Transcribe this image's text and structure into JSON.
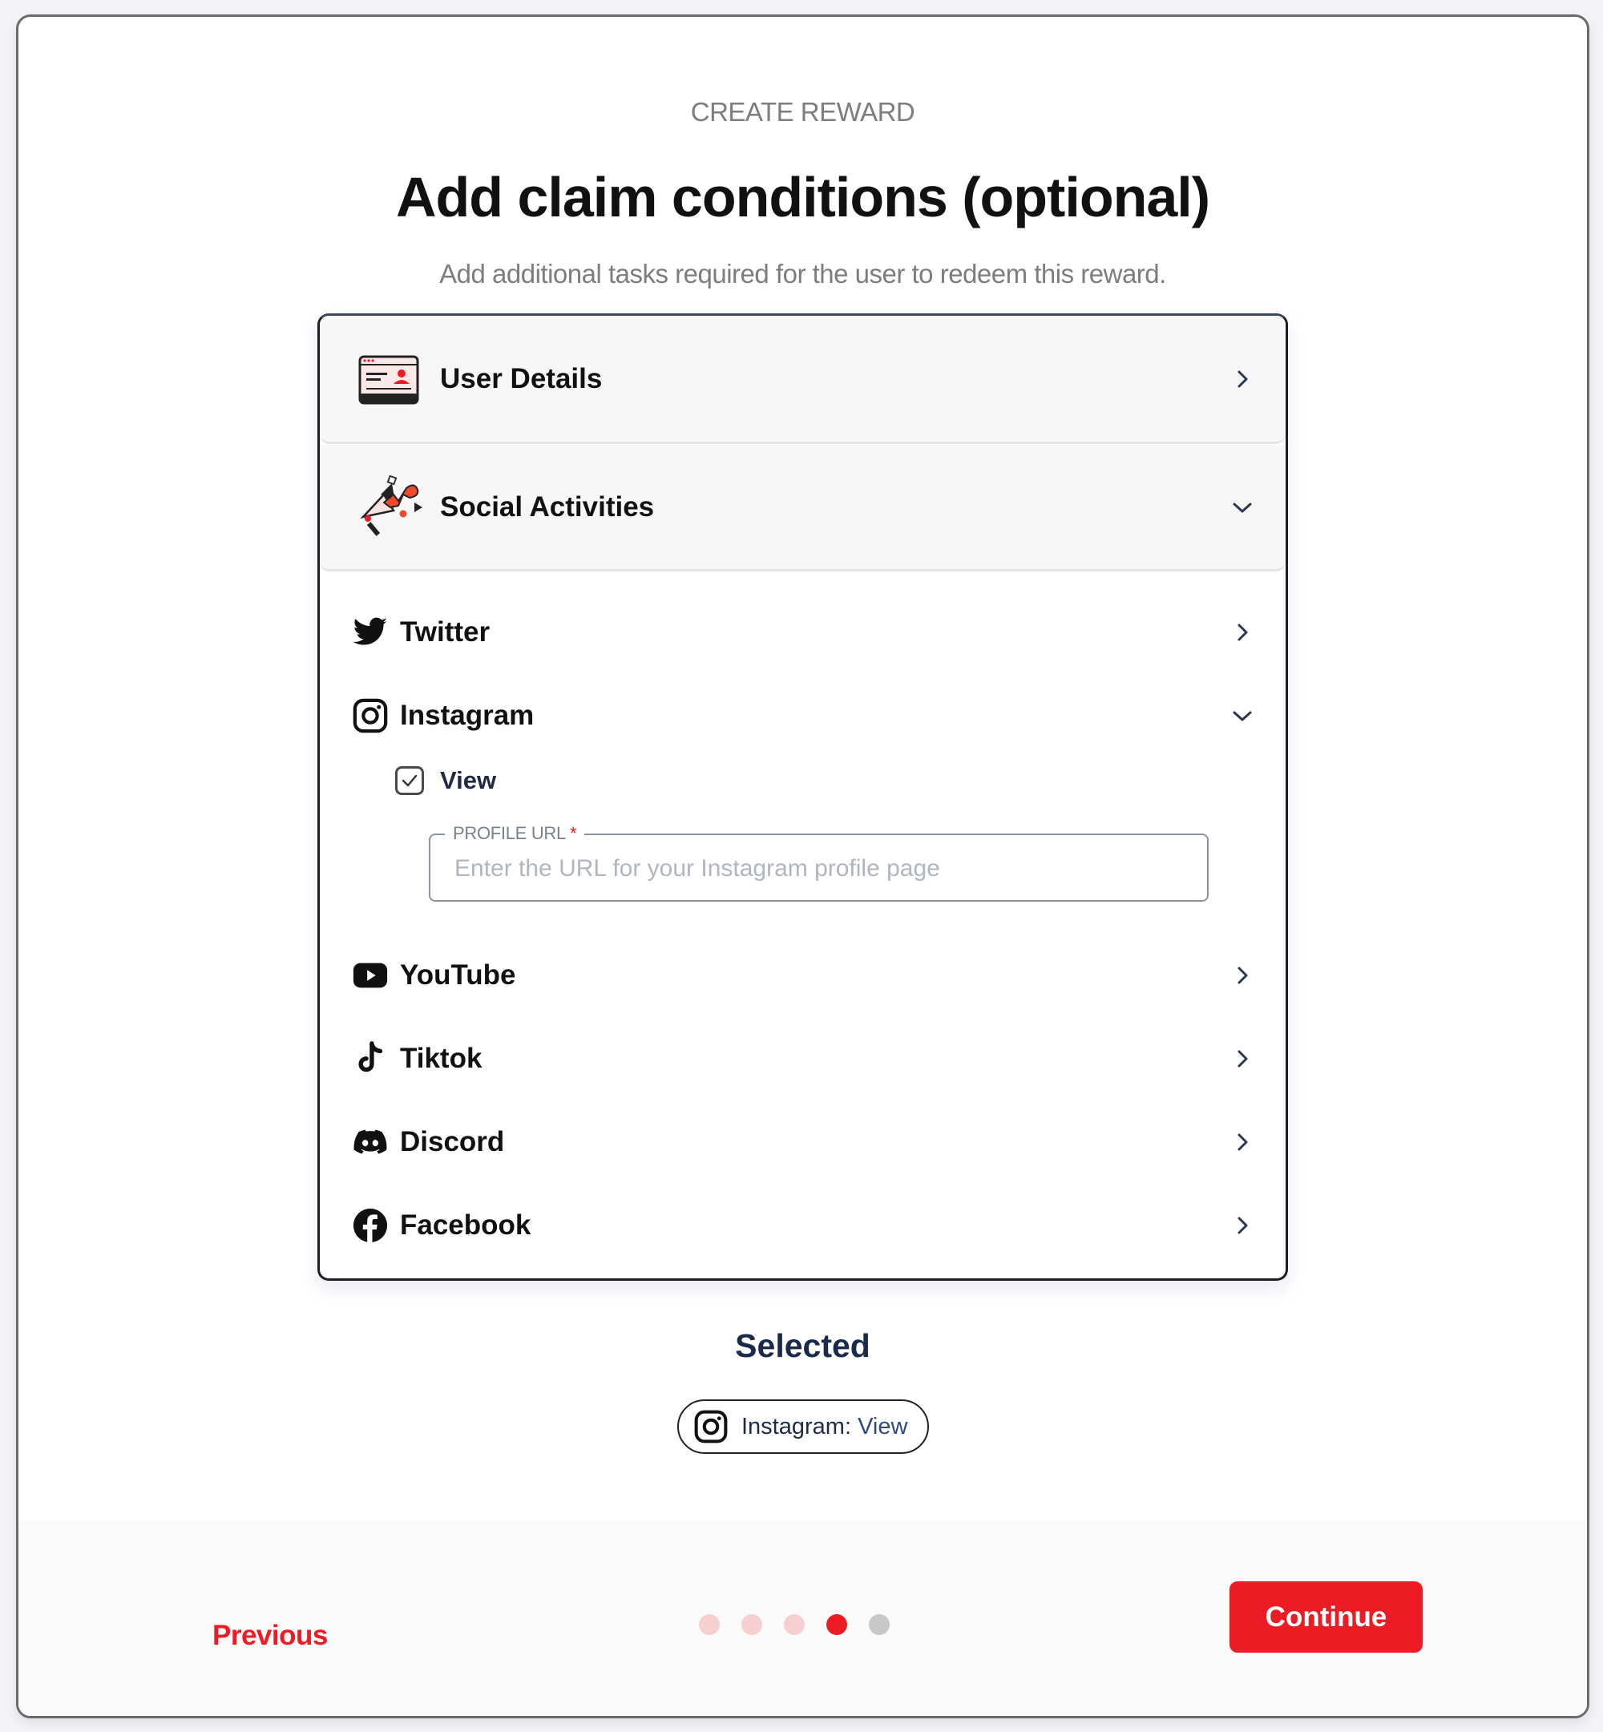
{
  "header": {
    "eyebrow": "CREATE REWARD",
    "title": "Add claim conditions (optional)",
    "subtitle": "Add additional tasks required for the user to redeem this reward."
  },
  "sections": [
    {
      "label": "User Details",
      "icon": "id-card-icon",
      "expanded": false
    },
    {
      "label": "Social Activities",
      "icon": "megaphone-icon",
      "expanded": true
    }
  ],
  "social": {
    "items": [
      {
        "label": "Twitter",
        "icon": "twitter-icon",
        "expanded": false
      },
      {
        "label": "Instagram",
        "icon": "instagram-icon",
        "expanded": true
      },
      {
        "label": "YouTube",
        "icon": "youtube-icon",
        "expanded": false
      },
      {
        "label": "Tiktok",
        "icon": "tiktok-icon",
        "expanded": false
      },
      {
        "label": "Discord",
        "icon": "discord-icon",
        "expanded": false
      },
      {
        "label": "Facebook",
        "icon": "facebook-icon",
        "expanded": false
      }
    ],
    "instagram_options": {
      "view_label": "View",
      "view_checked": true,
      "profile_url_label": "PROFILE URL",
      "profile_url_required_mark": "*",
      "profile_url_value": "",
      "profile_url_placeholder": "Enter the URL for your Instagram profile page"
    }
  },
  "selected": {
    "title": "Selected",
    "chips": [
      {
        "platform": "Instagram",
        "separator": ":",
        "action": "View",
        "icon": "instagram-icon"
      }
    ]
  },
  "footer": {
    "previous_label": "Previous",
    "continue_label": "Continue",
    "steps_total": 5,
    "current_step": 4,
    "colors": {
      "completed": "#f6cfd1",
      "current": "#ed1c24",
      "upcoming": "#c8c8c8",
      "accent": "#ed1c24"
    }
  }
}
